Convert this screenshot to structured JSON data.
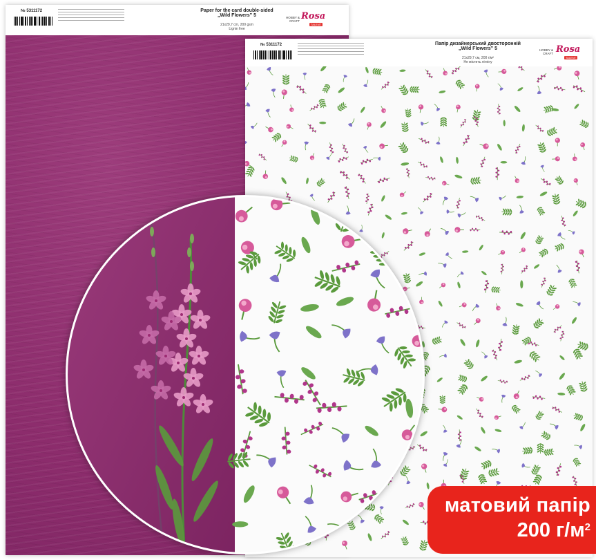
{
  "sheet_back": {
    "article": "№ 5311172",
    "title_line1": "Paper for the card double-sided",
    "title_line2": "„Wild Flowers” 5",
    "spec": "21x29,7 cm, 200 gsm",
    "spec_2": "Lignin free",
    "hobby_label": "HOBBY & CRAFT",
    "logo": "Rosa",
    "logo_tag": "TALENT"
  },
  "sheet_front": {
    "article": "№ 5311172",
    "title_line1": "Папір дизайнерський двосторонній",
    "title_line2": "„Wild Flowers” 5",
    "spec": "21x29,7 cм, 200 г/м²",
    "spec_2": "Не містить лігніну",
    "hobby_label": "HOBBY & CRAFT",
    "logo": "Rosa",
    "logo_tag": "TALENT"
  },
  "badge": {
    "line1": "матовий папір",
    "line2": "200 г/м",
    "line2_sup": "2"
  },
  "colors": {
    "purple_paper": "#8c2c6c",
    "badge_red": "#e8241c",
    "logo_pink": "#c2185b",
    "flower_pink": "#d65a9a",
    "flower_violet": "#7e72c9",
    "leaf_green": "#5a9a3c"
  }
}
